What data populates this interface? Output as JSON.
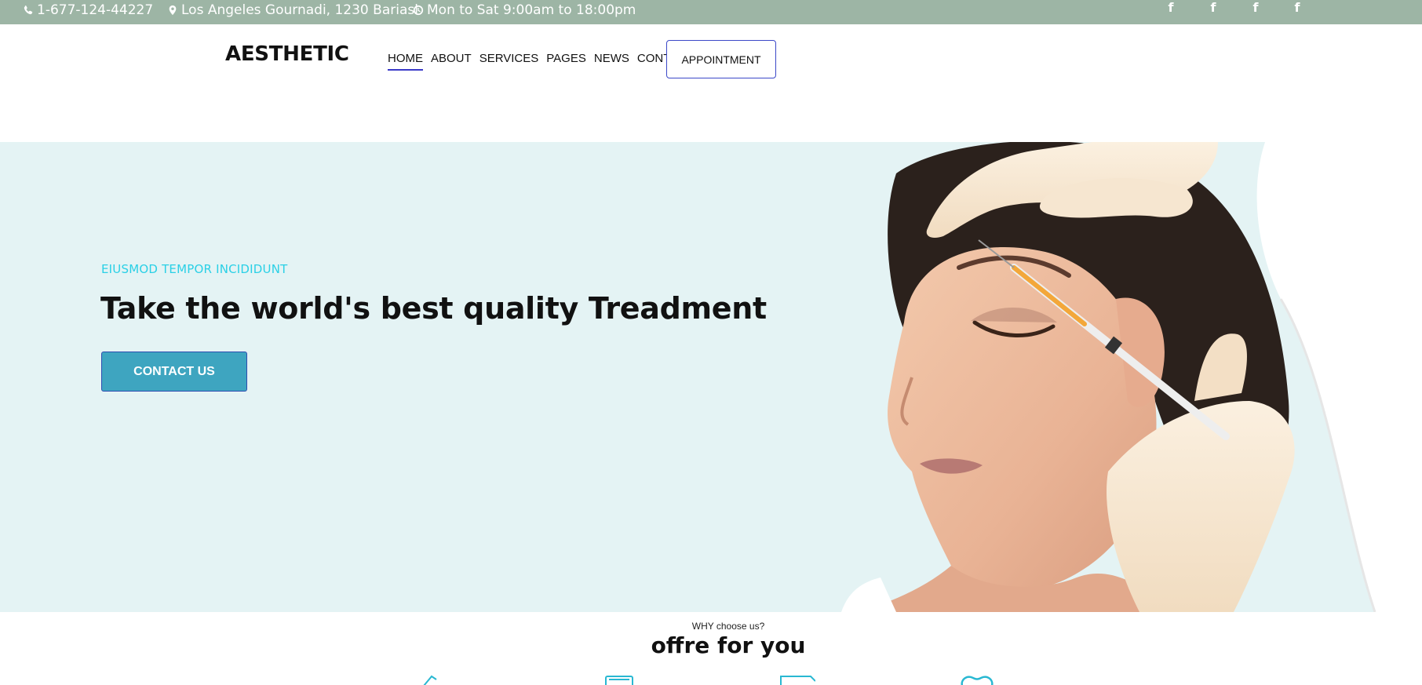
{
  "topbar": {
    "phone": "1-677-124-44227",
    "address": "Los Angeles Gournadi, 1230 Bariasl",
    "hours": "Mon to Sat 9:00am to 18:00pm",
    "social_icons": [
      "facebook-icon",
      "facebook-icon",
      "facebook-icon",
      "facebook-icon"
    ],
    "social_glyph": "f"
  },
  "header": {
    "logo": "AESTHETIC",
    "nav": [
      "HOME",
      "ABOUT",
      "SERVICES",
      "PAGES",
      "NEWS",
      "CONTACT"
    ],
    "active_nav": "HOME",
    "appointment": "APPOINTMENT"
  },
  "hero": {
    "eyebrow": "EIUSMOD TEMPOR INCIDIDUNT",
    "title": "Take the world's best quality Treadment",
    "button": "CONTACT US"
  },
  "why": {
    "small": "WHY choose us?",
    "title": "offre for you"
  },
  "colors": {
    "topbar": "#9db5a5",
    "accent": "#2ad0e6",
    "hero_bg": "#e4f3f4",
    "button": "#3ea5c0"
  }
}
